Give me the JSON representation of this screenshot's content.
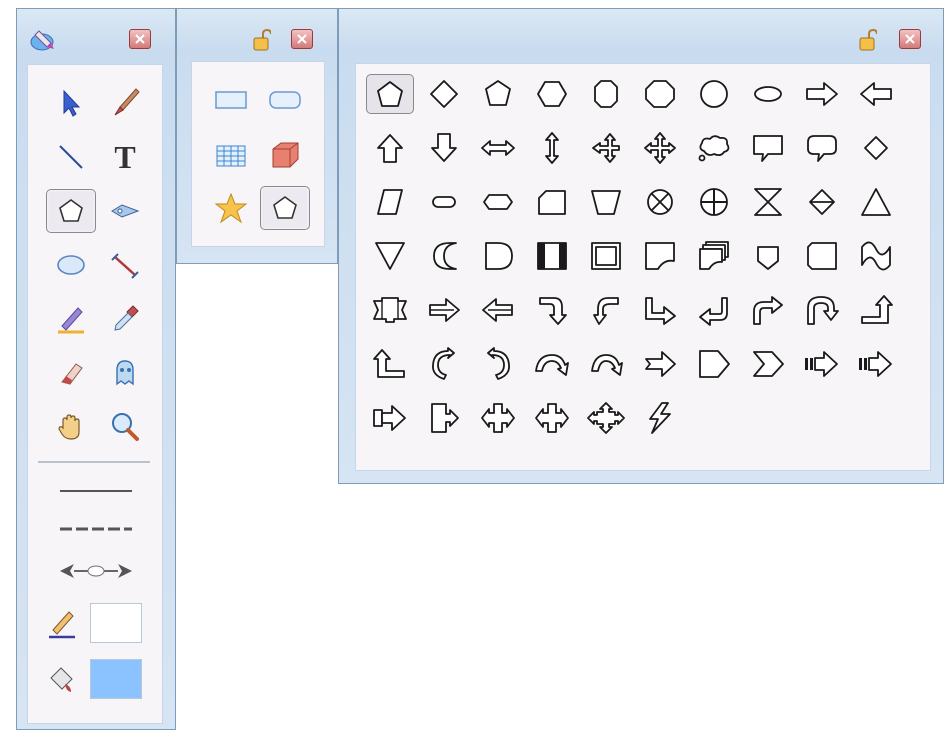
{
  "colors": {
    "line_color": "#ffffff",
    "fill_color": "#8ac3ff",
    "accent": "#3a6fd4"
  },
  "tools_panel": {
    "tools": [
      {
        "name": "select-tool-button",
        "icon": "arrow-cursor-icon"
      },
      {
        "name": "brush-tool-button",
        "icon": "paintbrush-icon"
      },
      {
        "name": "line-tool-button",
        "icon": "line-icon"
      },
      {
        "name": "text-tool-button",
        "icon": "text-icon"
      },
      {
        "name": "shape-tool-button",
        "icon": "pentagon-icon",
        "selected": true
      },
      {
        "name": "pen-tool-button",
        "icon": "pen-nib-icon"
      },
      {
        "name": "ellipse-tool-button",
        "icon": "ellipse-icon"
      },
      {
        "name": "measure-tool-button",
        "icon": "measure-icon"
      },
      {
        "name": "highlighter-tool-button",
        "icon": "highlighter-icon"
      },
      {
        "name": "eyedropper-tool-button",
        "icon": "eyedropper-icon"
      },
      {
        "name": "eraser-tool-button",
        "icon": "eraser-icon"
      },
      {
        "name": "stamp-tool-button",
        "icon": "ghost-stamp-icon"
      },
      {
        "name": "pan-tool-button",
        "icon": "hand-icon"
      },
      {
        "name": "zoom-tool-button",
        "icon": "magnifier-icon"
      }
    ],
    "text_tool_glyph": "T"
  },
  "insert_panel": {
    "items": [
      {
        "name": "rectangle-button",
        "icon": "rectangle-icon"
      },
      {
        "name": "rounded-rectangle-button",
        "icon": "rounded-rectangle-icon"
      },
      {
        "name": "table-button",
        "icon": "table-icon"
      },
      {
        "name": "cube-button",
        "icon": "cube-icon"
      },
      {
        "name": "star-button",
        "icon": "star-icon"
      },
      {
        "name": "autoshape-button",
        "icon": "pentagon-icon",
        "selected": true
      }
    ]
  },
  "shapes_panel": {
    "rows": [
      [
        "pentagon",
        "diamond",
        "pentagon-outline",
        "hexagon",
        "octagon-vertical",
        "octagon",
        "decagon",
        "ellipse",
        "arrow-right",
        "arrow-left"
      ],
      [
        "arrow-up",
        "arrow-down",
        "arrow-left-right",
        "arrow-up-down",
        "arrow-quad-left",
        "arrow-quad",
        "cloud-callout",
        "callout-rect",
        "callout-round",
        "diamond-small"
      ],
      [
        "parallelogram",
        "rounded-pill",
        "hexagon-flat",
        "card",
        "trapezoid",
        "circle-x",
        "circle-plus",
        "hourglass",
        "sort",
        "triangle"
      ],
      [
        "triangle-down",
        "moon",
        "delay",
        "process-predefined",
        "frame",
        "document",
        "multi-document",
        "pentagon-down",
        "square",
        "wave"
      ],
      [
        "banner",
        "arrow-striped-right",
        "arrow-striped-left",
        "arrow-curved-down",
        "arrow-curved-down-left",
        "arrow-bent-right",
        "arrow-u-left",
        "arrow-turn-right",
        "arrow-u-turn",
        "arrow-bent-up"
      ],
      [
        "arrow-bent-up-left",
        "arrow-circular-left",
        "arrow-circular-right",
        "arrow-curved-up",
        "arrow-curved-up-right",
        "arrow-notched-right",
        "home-plate",
        "chevron",
        "arrow-striped-block",
        "arrow-striped-block-2"
      ],
      [
        "arrow-callout-right",
        "arrow-callout-door",
        "arrow-cross",
        "arrow-cross-2",
        "arrow-quad-callout",
        "lightning"
      ]
    ]
  }
}
